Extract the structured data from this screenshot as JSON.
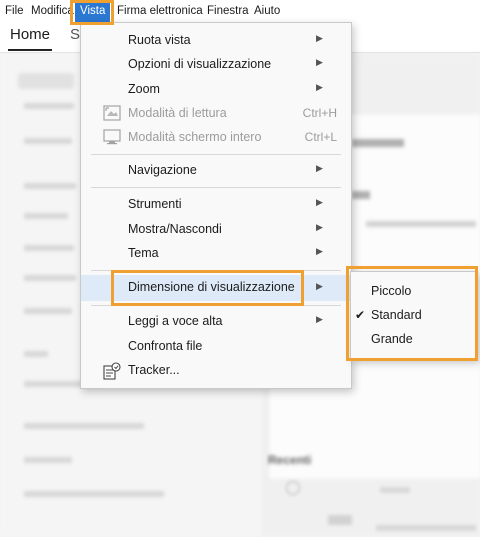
{
  "menubar": {
    "items": [
      {
        "label": "File"
      },
      {
        "label": "Modifica"
      },
      {
        "label": "Vista"
      },
      {
        "label": "Firma elettronica"
      },
      {
        "label": "Finestra"
      },
      {
        "label": "Aiuto"
      }
    ]
  },
  "tabs": {
    "home": "Home",
    "second": "S"
  },
  "menu": {
    "ruota_vista": "Ruota vista",
    "opzioni_visualizzazione": "Opzioni di visualizzazione",
    "zoom": "Zoom",
    "modalita_lettura": "Modalità di lettura",
    "modalita_lettura_shortcut": "Ctrl+H",
    "modalita_schermo_intero": "Modalità schermo intero",
    "modalita_schermo_intero_shortcut": "Ctrl+L",
    "navigazione": "Navigazione",
    "strumenti": "Strumenti",
    "mostra_nascondi": "Mostra/Nascondi",
    "tema": "Tema",
    "dimensione_visualizzazione": "Dimensione di visualizzazione",
    "leggi_voce_alta": "Leggi a voce alta",
    "confronta_file": "Confronta file",
    "tracker": "Tracker..."
  },
  "submenu": {
    "piccolo": "Piccolo",
    "standard": "Standard",
    "standard_checked": true,
    "grande": "Grande"
  },
  "background": {
    "recenti": "Recenti"
  },
  "colors": {
    "accent_blue": "#2b78d3",
    "highlight_orange": "#f0a030",
    "hover_row": "#dfeaf8"
  }
}
